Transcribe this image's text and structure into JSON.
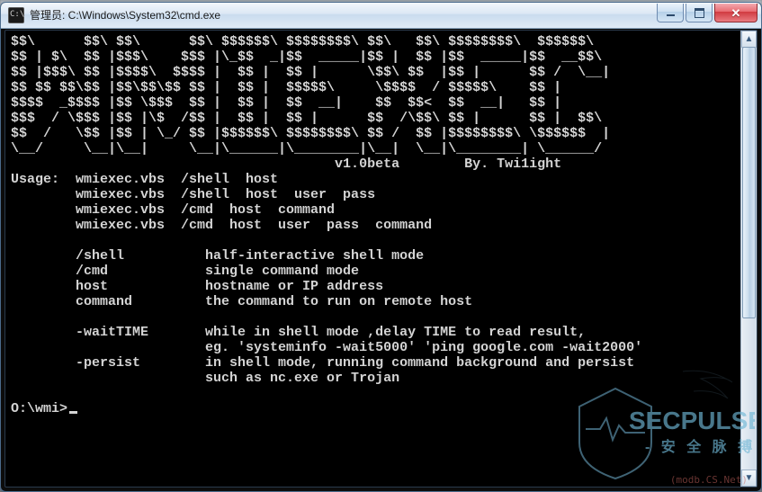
{
  "window": {
    "title": "管理员: C:\\Windows\\System32\\cmd.exe",
    "buttons": {
      "min": "–",
      "max": "□",
      "close": "✕"
    }
  },
  "ascii_art": [
    "$$\\      $$\\ $$\\      $$\\ $$$$$$\\ $$$$$$$$\\ $$\\   $$\\ $$$$$$$$\\  $$$$$$\\ ",
    "$$ | $\\  $$ |$$$\\    $$$ |\\_$$  _|$$  _____|$$ |  $$ |$$  _____|$$  __$$\\",
    "$$ |$$$\\ $$ |$$$$\\  $$$$ |  $$ |  $$ |      \\$$\\ $$  |$$ |      $$ /  \\__|",
    "$$ $$ $$\\$$ |$$\\$$\\$$ $$ |  $$ |  $$$$$\\     \\$$$$  / $$$$$\\    $$ |",
    "$$$$  _$$$$ |$$ \\$$$  $$ |  $$ |  $$  __|    $$  $$<  $$  __|   $$ |",
    "$$$  / \\$$$ |$$ |\\$  /$$ |  $$ |  $$ |      $$  /\\$$\\ $$ |      $$ |  $$\\",
    "$$  /   \\$$ |$$ | \\_/ $$ |$$$$$$\\ $$$$$$$$\\ $$ /  $$ |$$$$$$$$\\ \\$$$$$$  |",
    "\\__/     \\__|\\__|     \\__|\\______|\\________|\\__|  \\__|\\________| \\______/",
    "                                        v1.0beta        By. Twi1ight"
  ],
  "usage": {
    "heading": "Usage:",
    "syntaxes": [
      "wmiexec.vbs  /shell  host",
      "wmiexec.vbs  /shell  host  user  pass",
      "wmiexec.vbs  /cmd  host  command",
      "wmiexec.vbs  /cmd  host  user  pass  command"
    ],
    "options": [
      {
        "flag": "/shell",
        "desc": "half-interactive shell mode"
      },
      {
        "flag": "/cmd",
        "desc": "single command mode"
      },
      {
        "flag": "host",
        "desc": "hostname or IP address"
      },
      {
        "flag": "command",
        "desc": "the command to run on remote host"
      }
    ],
    "extras": [
      {
        "flag": "-waitTIME",
        "desc": [
          "while in shell mode ,delay TIME to read result,",
          "eg. 'systeminfo -wait5000' 'ping google.com -wait2000'"
        ]
      },
      {
        "flag": "-persist",
        "desc": [
          "in shell mode, running command background and persist",
          "such as nc.exe or Trojan"
        ]
      }
    ]
  },
  "prompt": "O:\\wmi>",
  "watermark": {
    "brand": "SECPULSE",
    "tagline": "- 安全脉搏 -",
    "sub": "(modb.CS.Net)"
  }
}
